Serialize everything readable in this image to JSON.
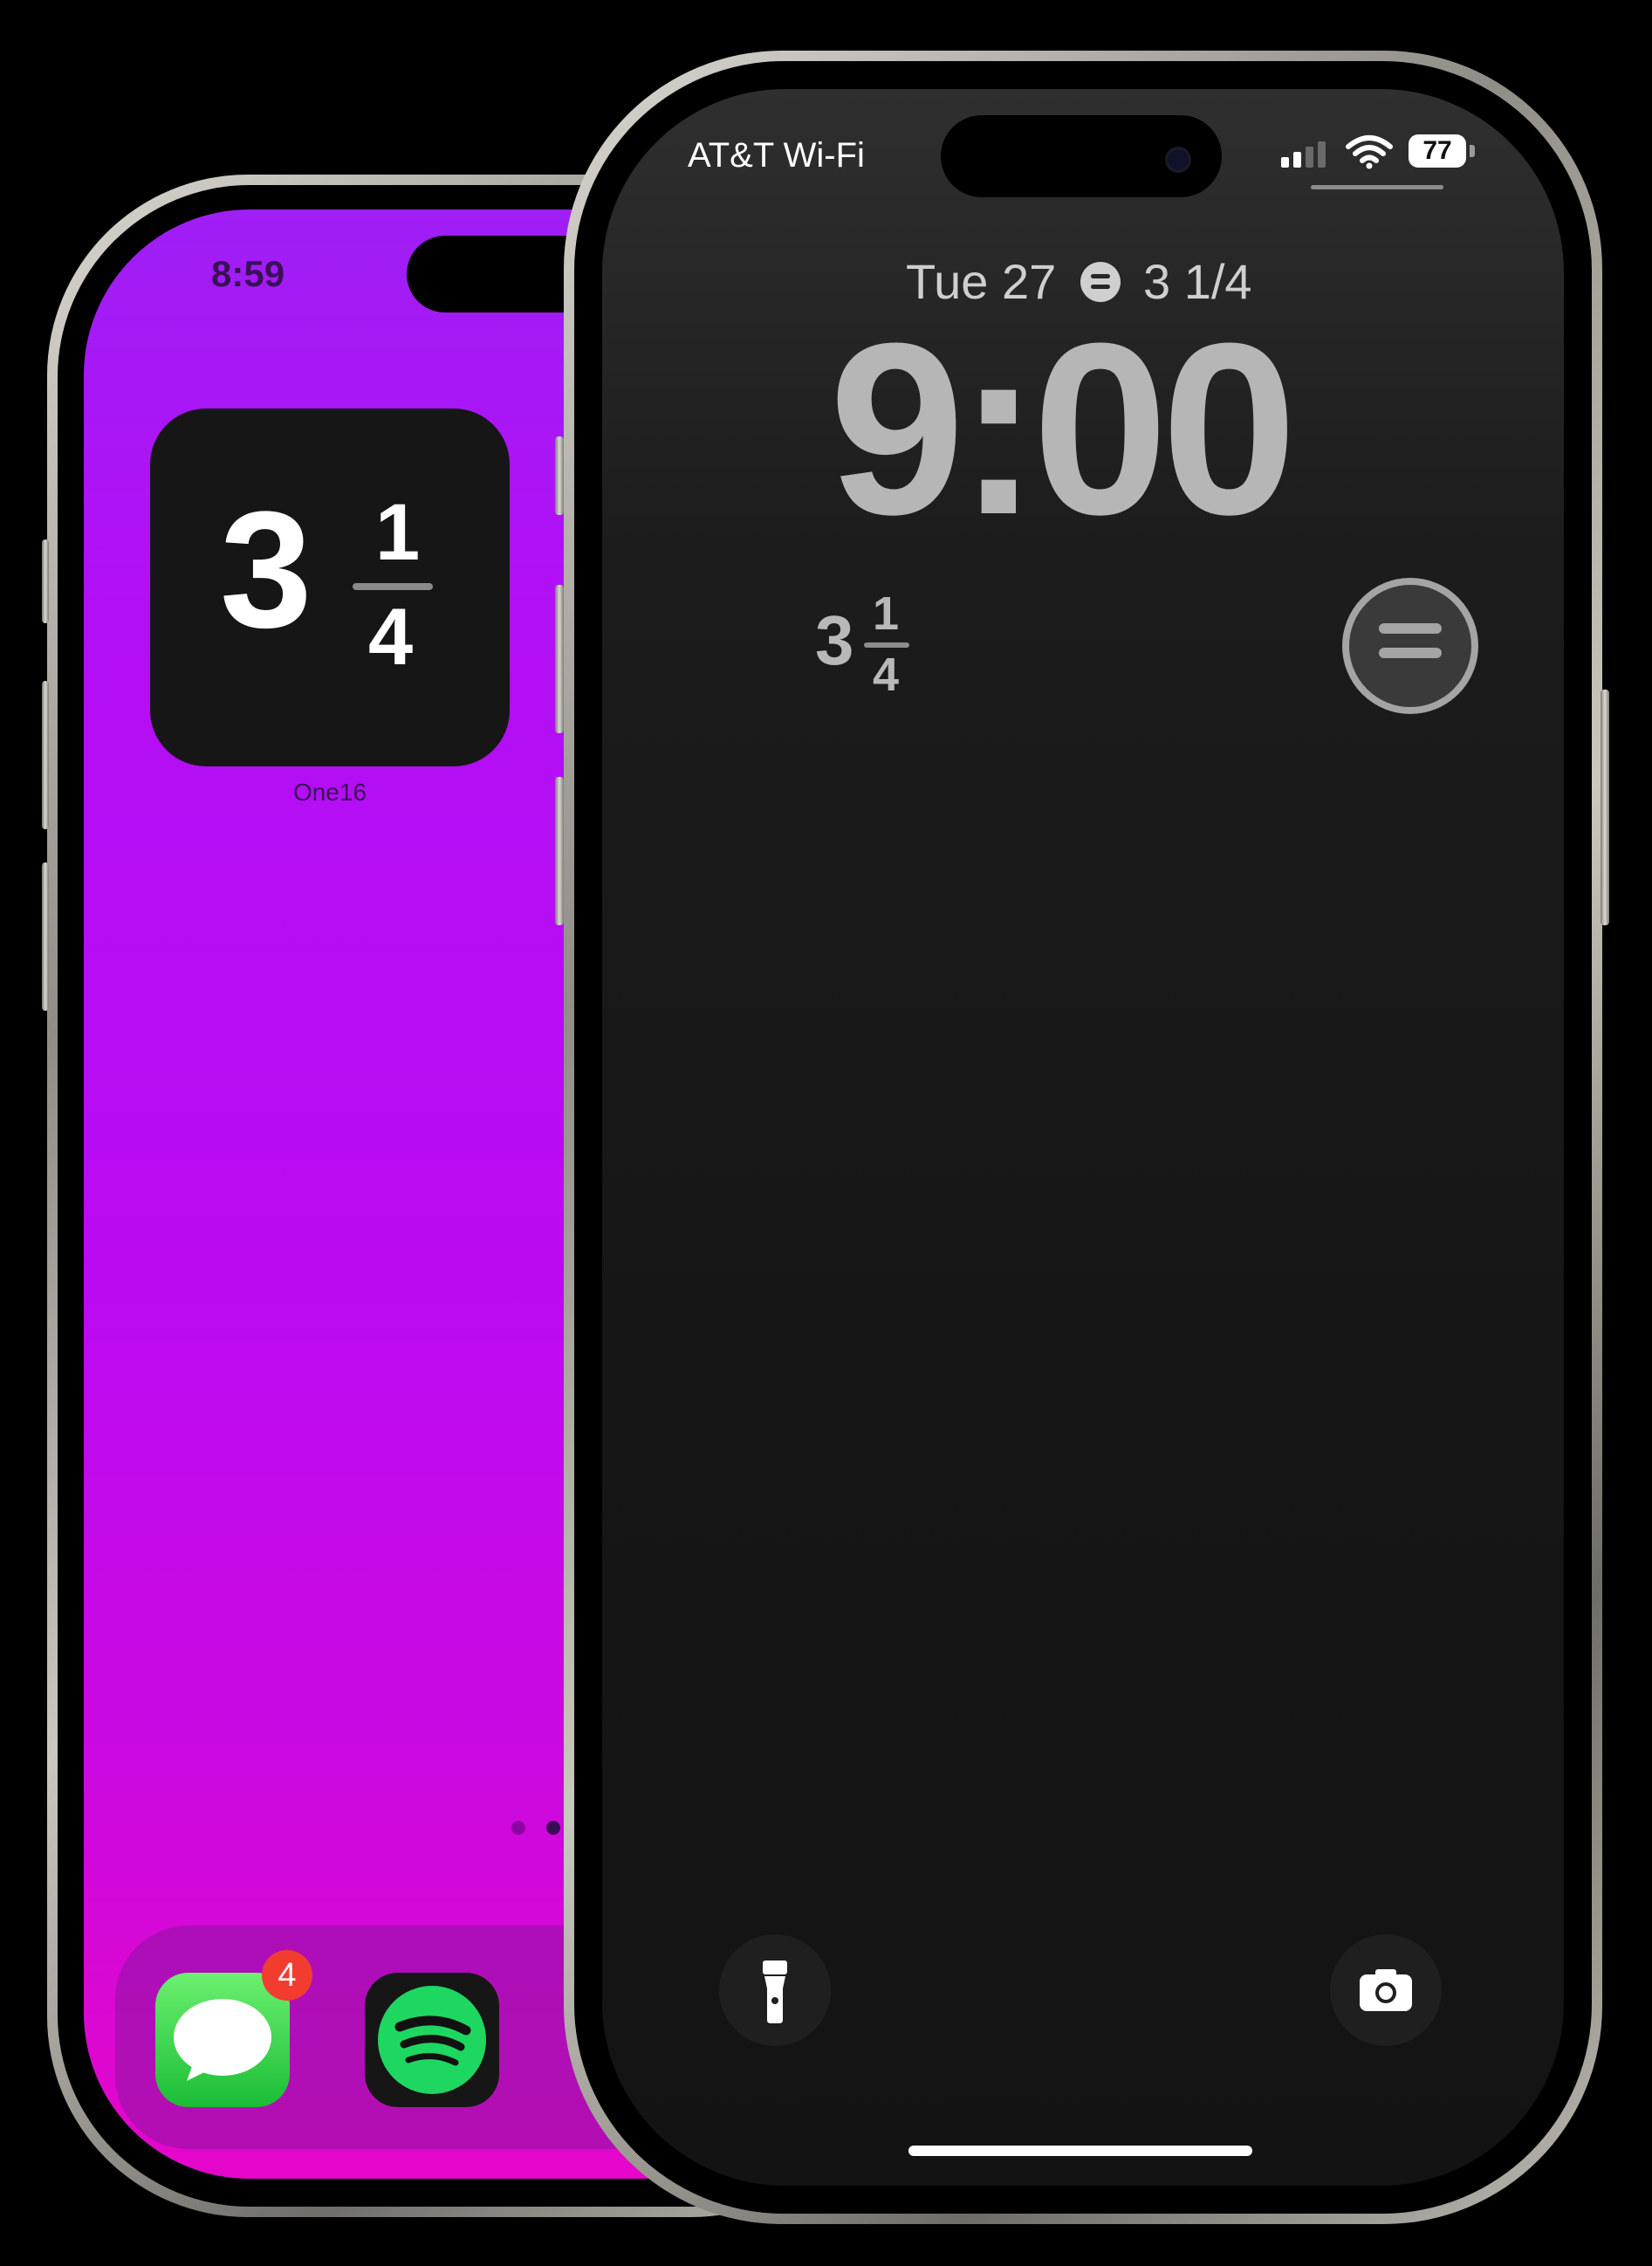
{
  "home_screen": {
    "status_time": "8:59",
    "widget": {
      "whole": "3",
      "numerator": "1",
      "denominator": "4",
      "label": "One16"
    },
    "page_indicator": {
      "count": 2,
      "active": 2
    },
    "dock": {
      "apps": [
        {
          "name": "Messages",
          "icon": "messages-icon",
          "badge": "4"
        },
        {
          "name": "Spotify",
          "icon": "spotify-icon"
        }
      ]
    }
  },
  "lock_screen": {
    "status_bar": {
      "carrier": "AT&T Wi-Fi",
      "signal_bars": 2,
      "wifi": "wifi-icon",
      "battery": "77"
    },
    "date": "Tue 27",
    "date_widget_icon": "equals-icon",
    "date_widget_value": "3 1/4",
    "time": "9:00",
    "widget": {
      "whole": "3",
      "numerator": "1",
      "denominator": "4"
    },
    "circle_widget_icon": "equals-icon",
    "flashlight": "flashlight-icon",
    "camera": "camera-icon"
  },
  "colors": {
    "home_wallpaper_top": "#9f1ff5",
    "home_wallpaper_bottom": "#e506c9",
    "lock_background": "#161616",
    "badge": "#f33c30",
    "spotify_green": "#1ed760"
  }
}
